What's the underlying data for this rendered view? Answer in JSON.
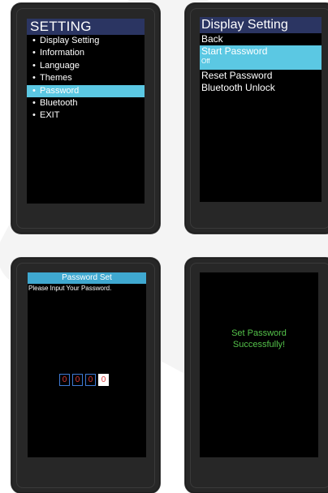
{
  "screen1": {
    "title": "SETTING",
    "items": [
      {
        "label": "Display Setting"
      },
      {
        "label": "Information"
      },
      {
        "label": "Language"
      },
      {
        "label": "Themes"
      },
      {
        "label": "Password"
      },
      {
        "label": "Bluetooth"
      },
      {
        "label": "EXIT"
      }
    ],
    "selected": "Password"
  },
  "screen2": {
    "title": "Display Setting",
    "back": "Back",
    "start_password": "Start Password",
    "start_password_value": "Off",
    "reset_password": "Reset Password",
    "bluetooth_unlock": "Bluetooth Unlock"
  },
  "screen3": {
    "title": "Password Set",
    "prompt": "Please Input Your Password.",
    "digits": [
      "0",
      "0",
      "0",
      "0"
    ]
  },
  "screen4": {
    "message_line1": "Set Password",
    "message_line2": "Successfully!"
  },
  "colors": {
    "title_bar": "#2b3562",
    "highlight": "#5bc8e3",
    "success_text": "#54c24a",
    "digit_text": "#d83a3a"
  }
}
